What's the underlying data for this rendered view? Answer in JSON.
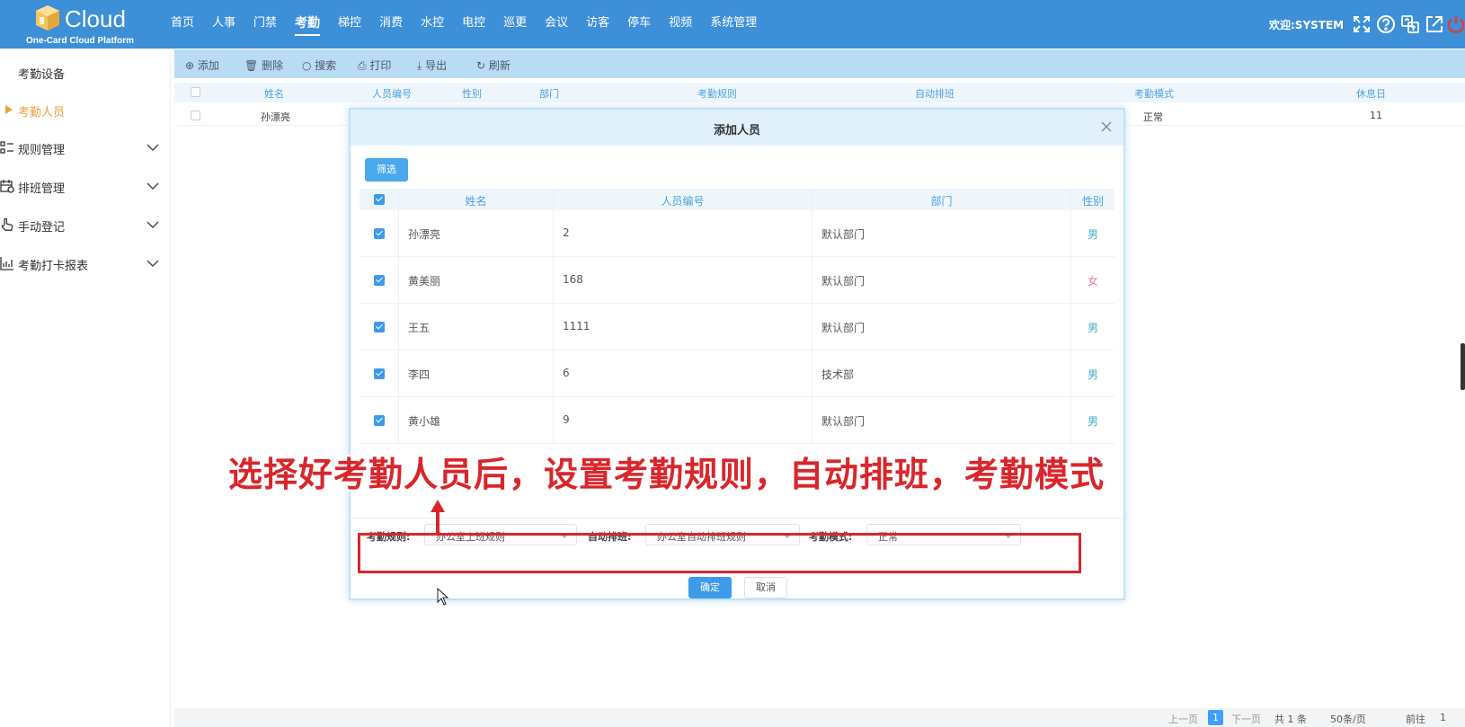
{
  "header": {
    "logo_text": "Cloud",
    "logo_subtitle": "One-Card Cloud Platform",
    "nav": [
      "首页",
      "人事",
      "门禁",
      "考勤",
      "梯控",
      "消费",
      "水控",
      "电控",
      "巡更",
      "会议",
      "访客",
      "停车",
      "视频",
      "系统管理"
    ],
    "active_nav": "考勤",
    "welcome": "欢迎:SYSTEM"
  },
  "sidebar": {
    "items": [
      {
        "label": "考勤设备"
      },
      {
        "label": "考勤人员"
      },
      {
        "label": "规则管理"
      },
      {
        "label": "排班管理"
      },
      {
        "label": "手动登记"
      },
      {
        "label": "考勤打卡报表"
      }
    ]
  },
  "toolbar": {
    "add": "添加",
    "delete": "删除",
    "search": "搜索",
    "print": "打印",
    "export": "导出",
    "refresh": "刷新"
  },
  "grid": {
    "columns": [
      "姓名",
      "人员编号",
      "性别",
      "部门",
      "考勤规则",
      "自动排班",
      "考勤模式",
      "休息日"
    ],
    "row": {
      "name": "孙漂亮",
      "mode": "正常",
      "rest_day": "11"
    }
  },
  "pagination": {
    "prev": "上一页",
    "current": "1",
    "next": "下一页",
    "total": "共 1 条",
    "page_size": "50条/页",
    "goto": "前往",
    "goto_value": "1"
  },
  "modal": {
    "title": "添加人员",
    "filter_button": "筛选",
    "columns": [
      "姓名",
      "人员编号",
      "部门",
      "性别"
    ],
    "rows": [
      {
        "name": "孙漂亮",
        "id": "2",
        "dept": "默认部门",
        "gender": "男"
      },
      {
        "name": "黄美丽",
        "id": "168",
        "dept": "默认部门",
        "gender": "女"
      },
      {
        "name": "王五",
        "id": "1111",
        "dept": "默认部门",
        "gender": "男"
      },
      {
        "name": "李四",
        "id": "6",
        "dept": "技术部",
        "gender": "男"
      },
      {
        "name": "黄小雄",
        "id": "9",
        "dept": "默认部门",
        "gender": "男"
      }
    ],
    "rule_label": "考勤规则:",
    "rule_value": "办公室上班规则",
    "schedule_label": "自动排班:",
    "schedule_value": "办公室自动排班规则",
    "mode_label": "考勤模式:",
    "mode_value": "正常",
    "ok": "确定",
    "cancel": "取消"
  },
  "annotation": {
    "text": "选择好考勤人员后，设置考勤规则，自动排班，考勤模式",
    "color": "#d9262b"
  },
  "colors": {
    "header": "#3d8fd8",
    "accent": "#3d9be9",
    "sidebar_active": "#e8a33d"
  }
}
